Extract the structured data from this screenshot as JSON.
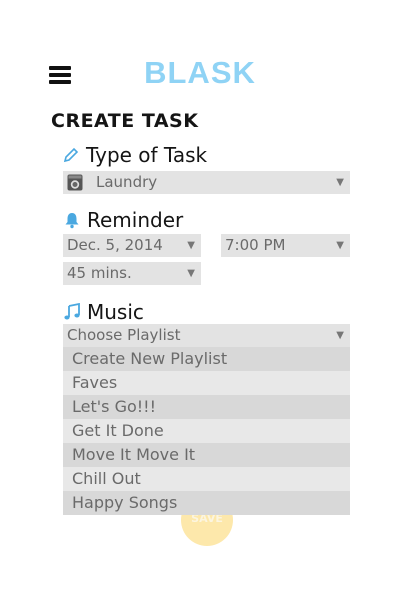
{
  "header": {
    "brand": "BLASK",
    "menu_icon": "hamburger-menu-icon"
  },
  "page_title": "CREATE TASK",
  "type_of_task": {
    "label": "Type of Task",
    "icon": "pencil-icon",
    "value": "Laundry",
    "value_icon": "washing-machine-icon"
  },
  "reminder": {
    "label": "Reminder",
    "icon": "bell-icon",
    "date": "Dec. 5, 2014",
    "time": "7:00 PM",
    "duration": "45 mins."
  },
  "music": {
    "label": "Music",
    "icon": "music-note-icon",
    "placeholder": "Choose Playlist",
    "options": [
      "Create New Playlist",
      "Faves",
      "Let's Go!!!",
      "Get It Done",
      "Move It Move It",
      "Chill Out",
      "Happy Songs"
    ]
  },
  "save_label": "SAVE",
  "colors": {
    "accent": "#8fd3f5",
    "save": "#fde8ab"
  }
}
